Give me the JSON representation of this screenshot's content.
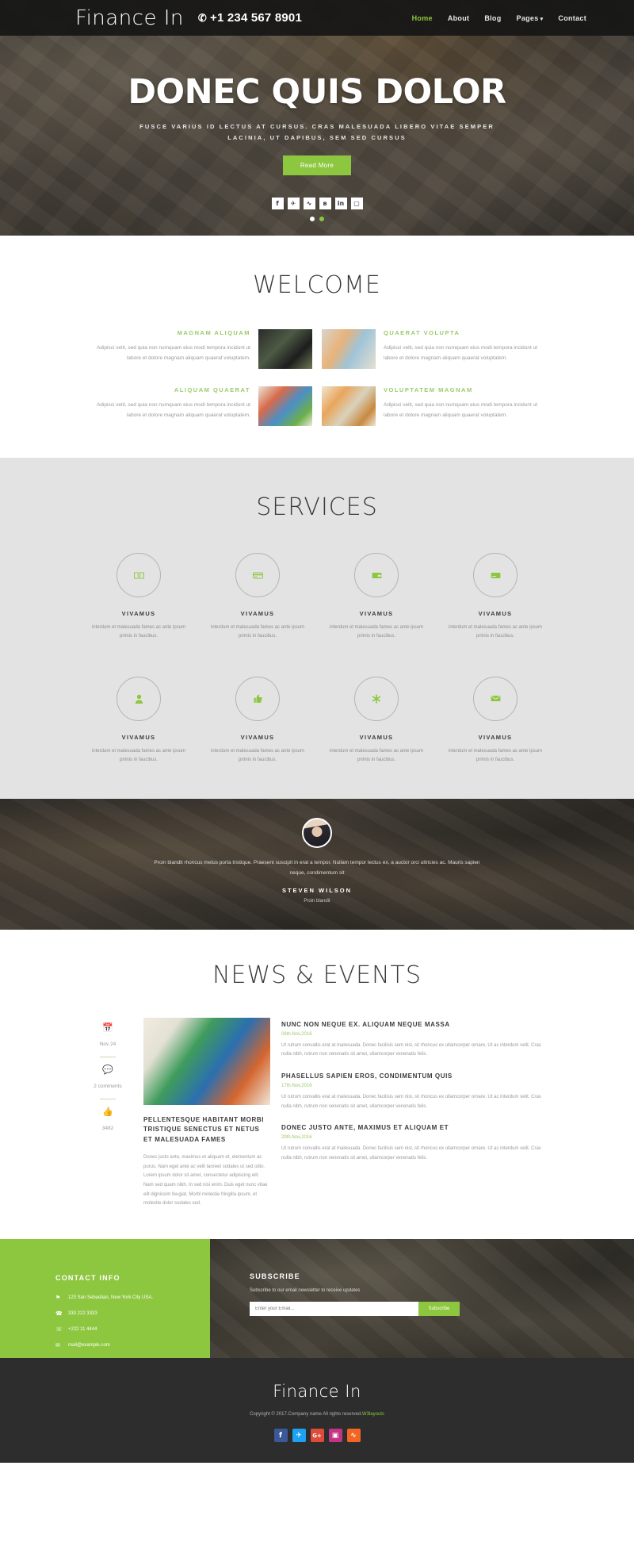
{
  "header": {
    "brand": "Finance In",
    "phone": "+1 234 567 8901",
    "phone_icon": "phone-icon",
    "nav": [
      {
        "label": "Home",
        "active": true
      },
      {
        "label": "About",
        "active": false
      },
      {
        "label": "Blog",
        "active": false
      },
      {
        "label": "Pages",
        "active": false,
        "caret": "▾"
      },
      {
        "label": "Contact",
        "active": false
      }
    ]
  },
  "hero": {
    "title": "DONEC QUIS DOLOR",
    "subtitle": "FUSCE VARIUS ID LECTUS AT CURSUS. CRAS MALESUADA LIBERO VITAE SEMPER LACINIA, UT DAPIBUS, SEM SED CURSUS",
    "button": "Read More",
    "socials": [
      {
        "name": "facebook-icon",
        "glyph": "f"
      },
      {
        "name": "twitter-icon",
        "glyph": "✈"
      },
      {
        "name": "rss-icon",
        "glyph": "∿"
      },
      {
        "name": "vk-icon",
        "glyph": "в"
      },
      {
        "name": "linkedin-icon",
        "glyph": "in"
      },
      {
        "name": "instagram-icon",
        "glyph": "▢"
      }
    ],
    "dots": [
      false,
      true
    ]
  },
  "welcome": {
    "title": "WELCOME",
    "cards": [
      {
        "heading": "MAGNAM ALIQUAM",
        "text": "Adipisci velit, sed quia non numquam eius modi tempora incidunt ut labore et dolore magnam aliquam quaerat voluptatem.",
        "image": "im1",
        "side": "right"
      },
      {
        "heading": "QUAERAT VOLUPTA",
        "text": "Adipisci velit, sed quia non numquam eius modi tempora incidunt ut labore et dolore magnam aliquam quaerat voluptatem.",
        "image": "im2",
        "side": "left"
      },
      {
        "heading": "ALIQUAM QUAERAT",
        "text": "Adipisci velit, sed quia non numquam eius modi tempora incidunt ut labore et dolore magnam aliquam quaerat voluptatem.",
        "image": "im3",
        "side": "right"
      },
      {
        "heading": "VOLUPTATEM MAGNAM",
        "text": "Adipisci velit, sed quia non numquam eius modi tempora incidunt ut labore et dolore magnam aliquam quaerat voluptatem.",
        "image": "im4",
        "side": "left"
      }
    ]
  },
  "services": {
    "title": "SERVICES",
    "items": [
      {
        "icon": "money-bill-icon",
        "glyph": "Ὃ5",
        "heading": "VIVAMUS",
        "text": "interdum et malesuada fames ac ante ipsum primis in faucibus."
      },
      {
        "icon": "credit-card-icon",
        "glyph": "▤",
        "heading": "VIVAMUS",
        "text": "interdum et malesuada fames ac ante ipsum primis in faucibus."
      },
      {
        "icon": "wallet-icon",
        "glyph": "▬",
        "heading": "VIVAMUS",
        "text": "interdum et malesuada fames ac ante ipsum primis in faucibus."
      },
      {
        "icon": "stripe-card-icon",
        "glyph": "▭",
        "heading": "VIVAMUS",
        "text": "interdum et malesuada fames ac ante ipsum primis in faucibus."
      },
      {
        "icon": "user-icon",
        "glyph": "♟",
        "heading": "VIVAMUS",
        "text": "interdum et malesuada fames ac ante ipsum primis in faucibus."
      },
      {
        "icon": "thumbs-up-icon",
        "glyph": "✋",
        "heading": "VIVAMUS",
        "text": "interdum et malesuada fames ac ante ipsum primis in faucibus."
      },
      {
        "icon": "asterisk-icon",
        "glyph": "✱",
        "heading": "VIVAMUS",
        "text": "interdum et malesuada fames ac ante ipsum primis in faucibus."
      },
      {
        "icon": "envelope-icon",
        "glyph": "✉",
        "heading": "VIVAMUS",
        "text": "interdum et malesuada fames ac ante ipsum primis in faucibus."
      }
    ]
  },
  "testimonial": {
    "quote": "Proin blandit rhoncus metus porta tristique. Praesent suscipit in erat a tempor. Nullam tempor lectus ex, a auctor orci ultricies ac. Mauris sapien neque, condimentum sit",
    "name": "STEVEN WILSON",
    "role": "Proin blandit",
    "avatar": "avatar"
  },
  "news": {
    "title": "NEWS & EVENTS",
    "meta": [
      {
        "icon": "calendar-icon",
        "glyph": "Ὄ5",
        "label": "Nov 24"
      },
      {
        "icon": "comment-icon",
        "glyph": "ὊC",
        "label": "2 comments"
      },
      {
        "icon": "like-icon",
        "glyph": "ὄD",
        "label": "3482"
      }
    ],
    "feature": {
      "heading": "PELLENTESQUE HABITANT MORBI TRISTIQUE SENECTUS ET NETUS ET MALESUADA FAMES",
      "text": "Donec justo ante, maximus et aliquam et, elementum ac purus. Nam eget ante ac velit laoreet sodales ut sed odio. Lorem ipsum dolor sit amet, consectetur adipiscing elit. Nam sed quam nibh. In sed nisi enim. Duis eget nunc vitae elit dignissim feugiat. Morbi molestie fringilla ipsum, et molestie dolor sodales sed."
    },
    "items": [
      {
        "heading": "NUNC NON NEQUE EX. ALIQUAM NEQUE MASSA",
        "date": "06th.Nov,2016",
        "text": "Ut rutrum convallis erat at malesuada. Donec facilisis sem nisl, sit rhoncus ex ullamcorper ornare. Ut ac interdum velit. Cras nulla nibh, rutrum non venenatis sit amet, ullamcorper venenatis felis."
      },
      {
        "heading": "PHASELLUS SAPIEN EROS, CONDIMENTUM QUIS",
        "date": "17th.Nov,2016",
        "text": "Ut rutrum convallis erat at malesuada. Donec facilisis sem nisl, sit rhoncus ex ullamcorper ornare. Ut ac interdum velit. Cras nulla nibh, rutrum non venenatis sit amet, ullamcorper venenatis felis."
      },
      {
        "heading": "DONEC JUSTO ANTE, MAXIMUS ET ALIQUAM ET",
        "date": "29th.Nov,2016",
        "text": "Ut rutrum convallis erat at malesuada. Donec facilisis sem nisl, sit rhoncus ex ullamcorper ornare. Ut ac interdum velit. Cras nulla nibh, rutrum non venenatis sit amet, ullamcorper venenatis felis."
      }
    ]
  },
  "contact": {
    "title": "CONTACT INFO",
    "rows": [
      {
        "icon": "location-icon",
        "glyph": "⌖",
        "text": "123 San Sebastian, New York City USA."
      },
      {
        "icon": "phone-icon",
        "glyph": "☎",
        "text": "333 222 3333"
      },
      {
        "icon": "mobile-icon",
        "glyph": "☏",
        "text": "+222 11 4444"
      },
      {
        "icon": "email-icon",
        "glyph": "✉",
        "text": "mail@example.com"
      }
    ]
  },
  "subscribe": {
    "title": "SUBSCRIBE",
    "subtitle": "Subscribe to our email newsletter to receive updates",
    "placeholder": "Enter your Email...",
    "button": "Subscribe"
  },
  "footer": {
    "brand": "Finance In",
    "copyright": "Copyright © 2017.Company name All rights reserved.",
    "credit_link": "W3layouts",
    "socials": [
      {
        "name": "facebook-icon",
        "glyph": "f",
        "color": "#3b5998"
      },
      {
        "name": "twitter-icon",
        "glyph": "✈",
        "color": "#1da1f2"
      },
      {
        "name": "google-plus-icon",
        "glyph": "G+",
        "color": "#dd4b39"
      },
      {
        "name": "instagram-icon",
        "glyph": "▣",
        "color": "#c13584"
      },
      {
        "name": "rss-icon",
        "glyph": "∿",
        "color": "#f26522"
      }
    ]
  },
  "colors": {
    "accent": "#8dc63f",
    "dark": "#2d2d2d",
    "services_bg": "#e3e3e3"
  }
}
